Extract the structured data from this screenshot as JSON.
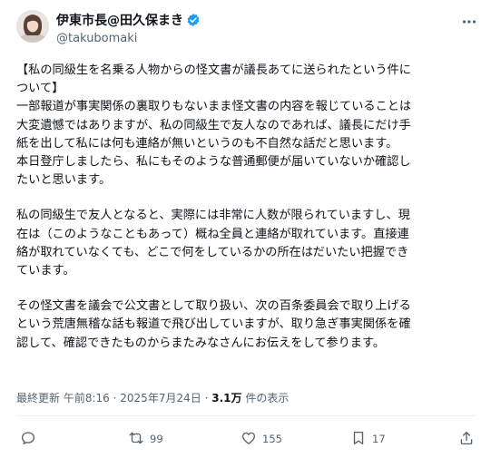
{
  "author": {
    "display_name": "伊東市長@田久保まき",
    "handle": "@takubomaki"
  },
  "tweet": {
    "paragraphs": [
      [
        "【私の同級生を名乗る人物からの怪文書が議長あてに送られたという件に",
        "ついて】",
        "一部報道が事実関係の裏取りもないまま怪文書の内容を報じていることは",
        "大変遺憾ではありますが、私の同級生で友人なのであれば、議長にだけ手",
        "紙を出して私には何も連絡が無いというのも不自然な話だと思います。",
        "本日登庁しましたら、私にもそのような普通郵便が届いていないか確認し",
        "たいと思います。"
      ],
      [
        "私の同級生で友人となると、実際には非常に人数が限られていますし、現",
        "在は（このようなこともあって）概ね全員と連絡が取れています。直接連",
        "絡が取れていなくても、どこで何をしているかの所在はだいたい把握でき",
        "ています。"
      ],
      [
        "その怪文書を議会で公文書として取り扱い、次の百条委員会で取り上げる",
        "という荒唐無稽な話も報道で飛び出していますが、取り急ぎ事実関係を確",
        "認して、確認できたものからまたみなさんにお伝えをして参ります。"
      ]
    ]
  },
  "meta": {
    "prefix": "最終更新",
    "time": "午前8:16",
    "separator": "·",
    "date": "2025年7月24日",
    "views_count": "3.1万",
    "views_label": "件の表示"
  },
  "actions": {
    "reply_count": "",
    "retweet_count": "99",
    "like_count": "155",
    "bookmark_count": "17"
  },
  "colors": {
    "text": "#0f1419",
    "secondary": "#536471",
    "verified": "#1d9bf0"
  },
  "icons": [
    "avatar",
    "verified-badge-icon",
    "more-icon",
    "reply-icon",
    "retweet-icon",
    "like-icon",
    "bookmark-icon",
    "share-icon"
  ]
}
